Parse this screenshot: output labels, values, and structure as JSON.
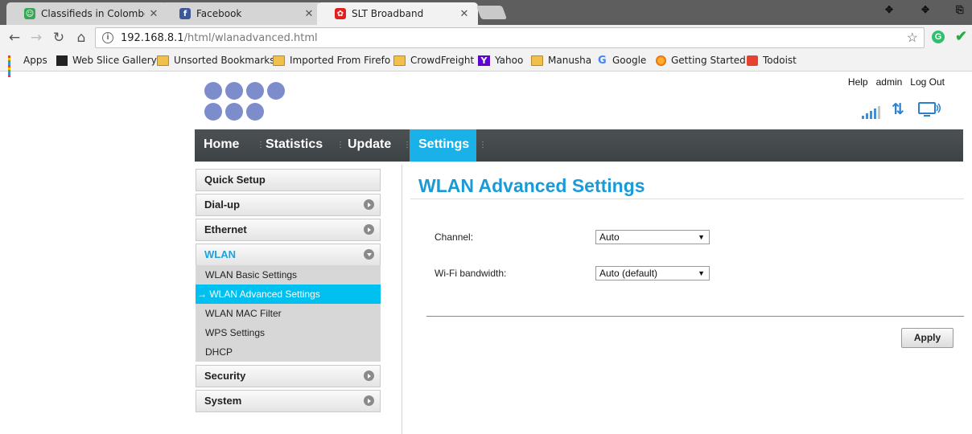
{
  "browser": {
    "tabs": [
      {
        "title": "Classifieds in Colombo o",
        "favicon_color": "#34a853"
      },
      {
        "title": "Facebook",
        "favicon_color": "#3b5998"
      },
      {
        "title": "SLT Broadband",
        "favicon_color": "#e02020"
      }
    ],
    "address": {
      "host": "192.168.8.1",
      "path": "/html/wlanadvanced.html"
    },
    "bookmarks": [
      {
        "label": "Apps",
        "icon": "apps-icon"
      },
      {
        "label": "Web Slice Gallery",
        "icon": "web-slice-icon"
      },
      {
        "label": "Unsorted Bookmarks",
        "icon": "folder-icon"
      },
      {
        "label": "Imported From Firefo",
        "icon": "folder-icon"
      },
      {
        "label": "CrowdFreight",
        "icon": "folder-icon"
      },
      {
        "label": "Yahoo",
        "icon": "yahoo-icon"
      },
      {
        "label": "Manusha",
        "icon": "folder-icon"
      },
      {
        "label": "Google",
        "icon": "google-icon"
      },
      {
        "label": "Getting Started",
        "icon": "firefox-icon"
      },
      {
        "label": "Todoist",
        "icon": "todoist-icon"
      }
    ]
  },
  "router": {
    "top_links": {
      "help": "Help",
      "user": "admin",
      "logout": "Log Out"
    },
    "nav": [
      "Home",
      "Statistics",
      "Update",
      "Settings"
    ],
    "active_nav": "Settings",
    "sidebar": {
      "quick_setup": "Quick Setup",
      "dialup": "Dial-up",
      "ethernet": "Ethernet",
      "wlan": "WLAN",
      "wlan_sub": [
        "WLAN Basic Settings",
        "WLAN Advanced Settings",
        "WLAN MAC Filter",
        "WPS Settings",
        "DHCP"
      ],
      "active_sub": "→ WLAN Advanced Settings",
      "security": "Security",
      "system": "System"
    },
    "page_title": "WLAN Advanced Settings",
    "fields": {
      "channel_label": "Channel:",
      "channel_value": "Auto",
      "bandwidth_label": "Wi-Fi bandwidth:",
      "bandwidth_value": "Auto (default)"
    },
    "apply_label": "Apply",
    "accent_color": "#1ab0e8"
  }
}
